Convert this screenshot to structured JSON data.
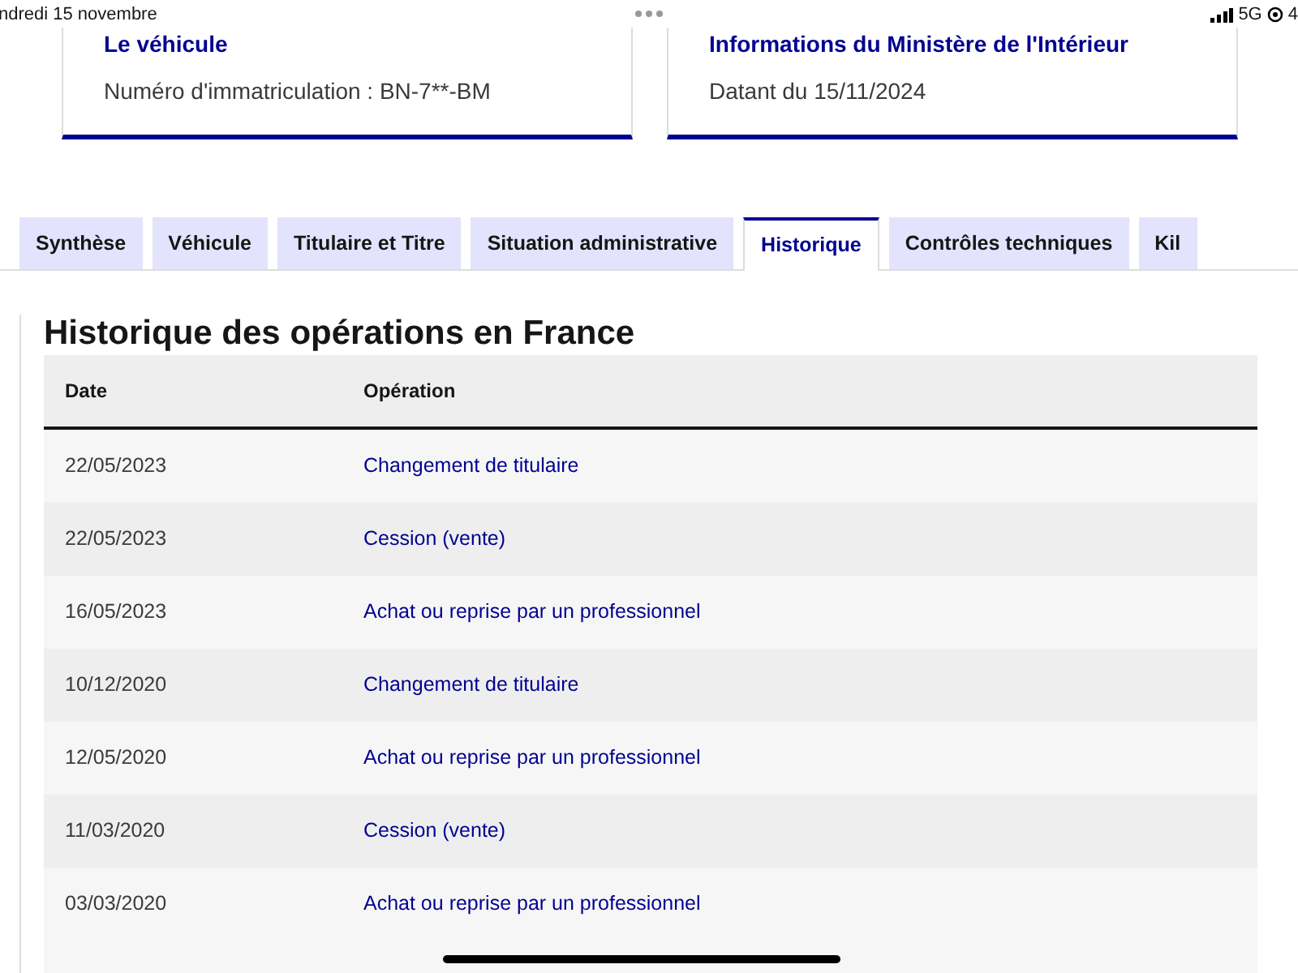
{
  "status_bar": {
    "date": "ndredi 15 novembre",
    "network": "5G",
    "battery": "4"
  },
  "cards": [
    {
      "title": "Le véhicule",
      "text": "Numéro d'immatriculation : BN-7**-BM"
    },
    {
      "title": "Informations du Ministère de l'Intérieur",
      "text": "Datant du 15/11/2024"
    }
  ],
  "tabs": [
    {
      "label": "Synthèse",
      "selected": false
    },
    {
      "label": "Véhicule",
      "selected": false
    },
    {
      "label": "Titulaire et Titre",
      "selected": false
    },
    {
      "label": "Situation administrative",
      "selected": false
    },
    {
      "label": "Historique",
      "selected": true
    },
    {
      "label": "Contrôles techniques",
      "selected": false
    },
    {
      "label": "Kil",
      "selected": false
    }
  ],
  "section_title": "Historique des opérations en France",
  "table": {
    "columns": [
      "Date",
      "Opération"
    ],
    "rows": [
      [
        "22/05/2023",
        "Changement de titulaire"
      ],
      [
        "22/05/2023",
        "Cession (vente)"
      ],
      [
        "16/05/2023",
        "Achat ou reprise par un professionnel"
      ],
      [
        "10/12/2020",
        "Changement de titulaire"
      ],
      [
        "12/05/2020",
        "Achat ou reprise par un professionnel"
      ],
      [
        "11/03/2020",
        "Cession (vente)"
      ],
      [
        "03/03/2020",
        "Achat ou reprise par un professionnel"
      ]
    ]
  }
}
